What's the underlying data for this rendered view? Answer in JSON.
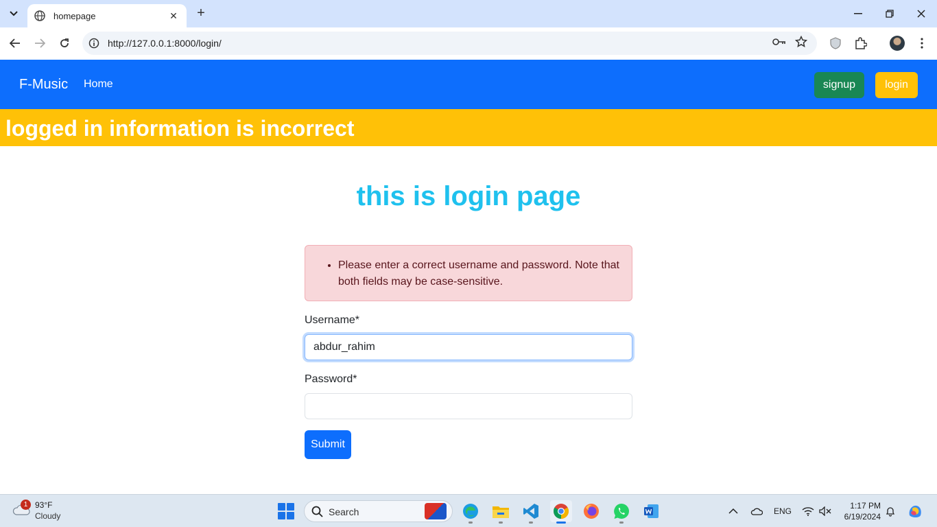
{
  "browser": {
    "tab_title": "homepage",
    "url": "http://127.0.0.1:8000/login/"
  },
  "navbar": {
    "brand": "F-Music",
    "home_link": "Home",
    "signup_label": "signup",
    "login_label": "login",
    "colors": {
      "navbar": "#0d6efd",
      "signup": "#198754",
      "login": "#ffc107"
    }
  },
  "banner": {
    "message": "logged in information is incorrect",
    "color": "#ffc107"
  },
  "page": {
    "title": "this is login page",
    "title_color": "#1fc1ee",
    "error_message": "Please enter a correct username and password. Note that both fields may be case-sensitive.",
    "username_label": "Username*",
    "username_value": "abdur_rahim",
    "password_label": "Password*",
    "password_value": "",
    "submit_label": "Submit"
  },
  "taskbar": {
    "weather_badge": "1",
    "weather_temp": "93°F",
    "weather_desc": "Cloudy",
    "search_placeholder": "Search",
    "language": "ENG",
    "time": "1:17 PM",
    "date": "6/19/2024",
    "apps": [
      "flag-icon",
      "edge-icon",
      "file-explorer-icon",
      "vscode-icon",
      "chrome-icon",
      "firefox-icon",
      "whatsapp-icon",
      "word-icon"
    ]
  }
}
